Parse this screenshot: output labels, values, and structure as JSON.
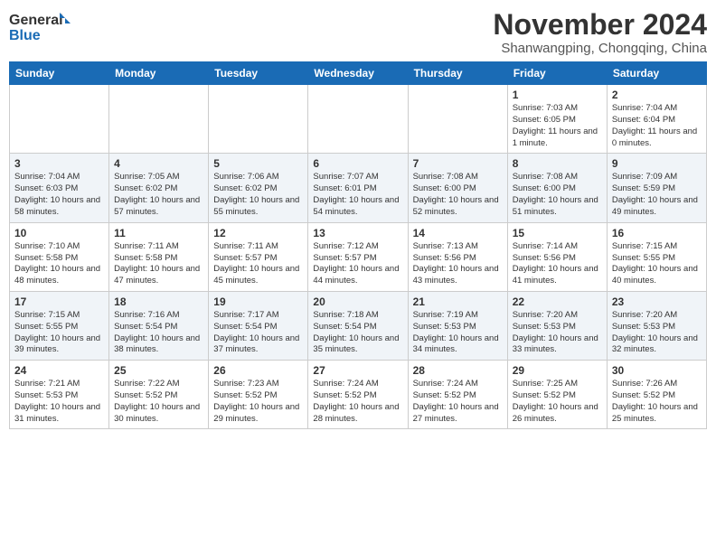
{
  "header": {
    "logo_line1": "General",
    "logo_line2": "Blue",
    "month_title": "November 2024",
    "subtitle": "Shanwangping, Chongqing, China"
  },
  "weekdays": [
    "Sunday",
    "Monday",
    "Tuesday",
    "Wednesday",
    "Thursday",
    "Friday",
    "Saturday"
  ],
  "weeks": [
    [
      {
        "day": "",
        "info": ""
      },
      {
        "day": "",
        "info": ""
      },
      {
        "day": "",
        "info": ""
      },
      {
        "day": "",
        "info": ""
      },
      {
        "day": "",
        "info": ""
      },
      {
        "day": "1",
        "info": "Sunrise: 7:03 AM\nSunset: 6:05 PM\nDaylight: 11 hours and 1 minute."
      },
      {
        "day": "2",
        "info": "Sunrise: 7:04 AM\nSunset: 6:04 PM\nDaylight: 11 hours and 0 minutes."
      }
    ],
    [
      {
        "day": "3",
        "info": "Sunrise: 7:04 AM\nSunset: 6:03 PM\nDaylight: 10 hours and 58 minutes."
      },
      {
        "day": "4",
        "info": "Sunrise: 7:05 AM\nSunset: 6:02 PM\nDaylight: 10 hours and 57 minutes."
      },
      {
        "day": "5",
        "info": "Sunrise: 7:06 AM\nSunset: 6:02 PM\nDaylight: 10 hours and 55 minutes."
      },
      {
        "day": "6",
        "info": "Sunrise: 7:07 AM\nSunset: 6:01 PM\nDaylight: 10 hours and 54 minutes."
      },
      {
        "day": "7",
        "info": "Sunrise: 7:08 AM\nSunset: 6:00 PM\nDaylight: 10 hours and 52 minutes."
      },
      {
        "day": "8",
        "info": "Sunrise: 7:08 AM\nSunset: 6:00 PM\nDaylight: 10 hours and 51 minutes."
      },
      {
        "day": "9",
        "info": "Sunrise: 7:09 AM\nSunset: 5:59 PM\nDaylight: 10 hours and 49 minutes."
      }
    ],
    [
      {
        "day": "10",
        "info": "Sunrise: 7:10 AM\nSunset: 5:58 PM\nDaylight: 10 hours and 48 minutes."
      },
      {
        "day": "11",
        "info": "Sunrise: 7:11 AM\nSunset: 5:58 PM\nDaylight: 10 hours and 47 minutes."
      },
      {
        "day": "12",
        "info": "Sunrise: 7:11 AM\nSunset: 5:57 PM\nDaylight: 10 hours and 45 minutes."
      },
      {
        "day": "13",
        "info": "Sunrise: 7:12 AM\nSunset: 5:57 PM\nDaylight: 10 hours and 44 minutes."
      },
      {
        "day": "14",
        "info": "Sunrise: 7:13 AM\nSunset: 5:56 PM\nDaylight: 10 hours and 43 minutes."
      },
      {
        "day": "15",
        "info": "Sunrise: 7:14 AM\nSunset: 5:56 PM\nDaylight: 10 hours and 41 minutes."
      },
      {
        "day": "16",
        "info": "Sunrise: 7:15 AM\nSunset: 5:55 PM\nDaylight: 10 hours and 40 minutes."
      }
    ],
    [
      {
        "day": "17",
        "info": "Sunrise: 7:15 AM\nSunset: 5:55 PM\nDaylight: 10 hours and 39 minutes."
      },
      {
        "day": "18",
        "info": "Sunrise: 7:16 AM\nSunset: 5:54 PM\nDaylight: 10 hours and 38 minutes."
      },
      {
        "day": "19",
        "info": "Sunrise: 7:17 AM\nSunset: 5:54 PM\nDaylight: 10 hours and 37 minutes."
      },
      {
        "day": "20",
        "info": "Sunrise: 7:18 AM\nSunset: 5:54 PM\nDaylight: 10 hours and 35 minutes."
      },
      {
        "day": "21",
        "info": "Sunrise: 7:19 AM\nSunset: 5:53 PM\nDaylight: 10 hours and 34 minutes."
      },
      {
        "day": "22",
        "info": "Sunrise: 7:20 AM\nSunset: 5:53 PM\nDaylight: 10 hours and 33 minutes."
      },
      {
        "day": "23",
        "info": "Sunrise: 7:20 AM\nSunset: 5:53 PM\nDaylight: 10 hours and 32 minutes."
      }
    ],
    [
      {
        "day": "24",
        "info": "Sunrise: 7:21 AM\nSunset: 5:53 PM\nDaylight: 10 hours and 31 minutes."
      },
      {
        "day": "25",
        "info": "Sunrise: 7:22 AM\nSunset: 5:52 PM\nDaylight: 10 hours and 30 minutes."
      },
      {
        "day": "26",
        "info": "Sunrise: 7:23 AM\nSunset: 5:52 PM\nDaylight: 10 hours and 29 minutes."
      },
      {
        "day": "27",
        "info": "Sunrise: 7:24 AM\nSunset: 5:52 PM\nDaylight: 10 hours and 28 minutes."
      },
      {
        "day": "28",
        "info": "Sunrise: 7:24 AM\nSunset: 5:52 PM\nDaylight: 10 hours and 27 minutes."
      },
      {
        "day": "29",
        "info": "Sunrise: 7:25 AM\nSunset: 5:52 PM\nDaylight: 10 hours and 26 minutes."
      },
      {
        "day": "30",
        "info": "Sunrise: 7:26 AM\nSunset: 5:52 PM\nDaylight: 10 hours and 25 minutes."
      }
    ]
  ]
}
